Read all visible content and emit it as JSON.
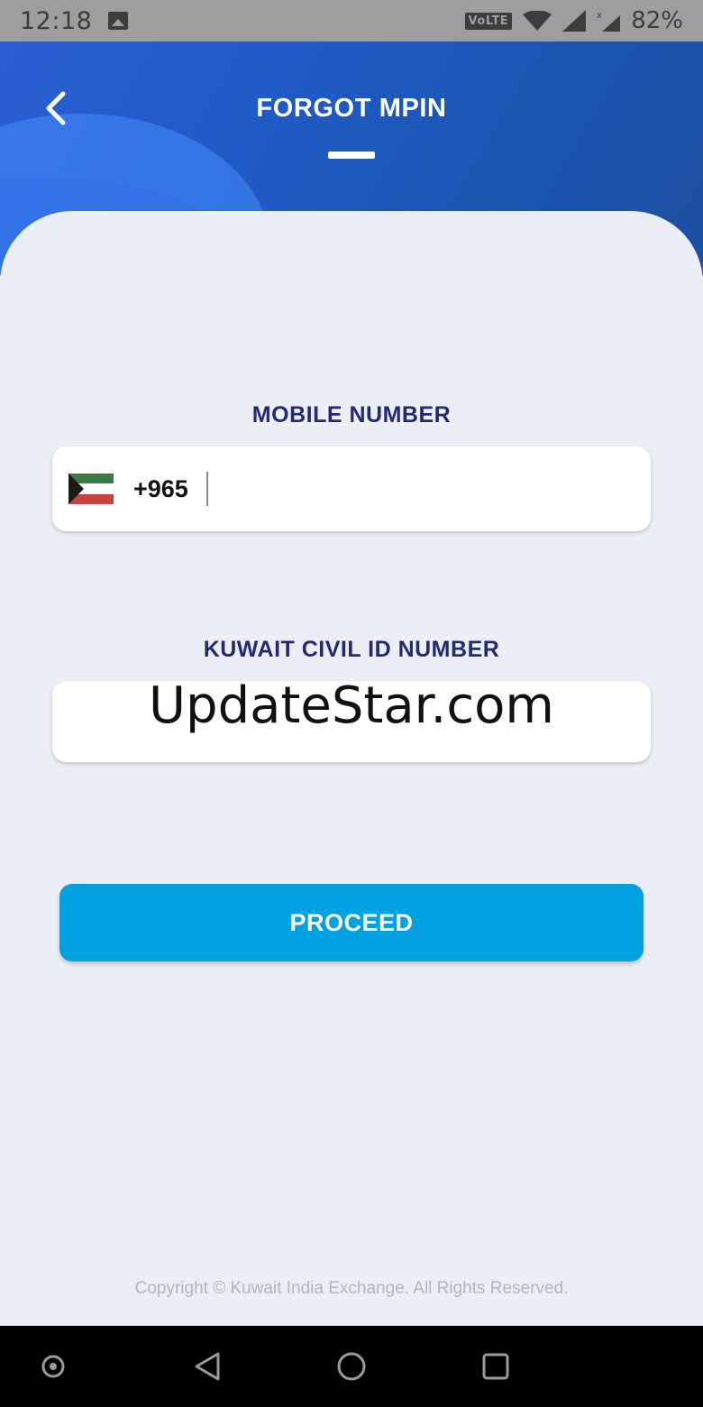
{
  "status_bar": {
    "time": "12:18",
    "network": "VoLTE",
    "battery": "82%"
  },
  "header": {
    "title": "FORGOT MPIN",
    "back_icon": "chevron-left-icon"
  },
  "form": {
    "mobile_label": "MOBILE NUMBER",
    "dial_code": "+965",
    "country_flag": "kuwait-flag-icon",
    "mobile_value": "",
    "civil_label": "KUWAIT CIVIL ID NUMBER",
    "civil_value": "",
    "proceed_label": "PROCEED"
  },
  "watermark": "UpdateStar.com",
  "footer": {
    "copyright": "Copyright © Kuwait India Exchange. All Rights Reserved."
  },
  "colors": {
    "header_blue": "#1f5ac4",
    "label_navy": "#232a72",
    "button_cyan": "#00a1e0",
    "background": "#eceef5"
  },
  "nav_bar": {
    "items": [
      "assistant-icon",
      "back-triangle-icon",
      "home-circle-icon",
      "recents-square-icon"
    ]
  }
}
